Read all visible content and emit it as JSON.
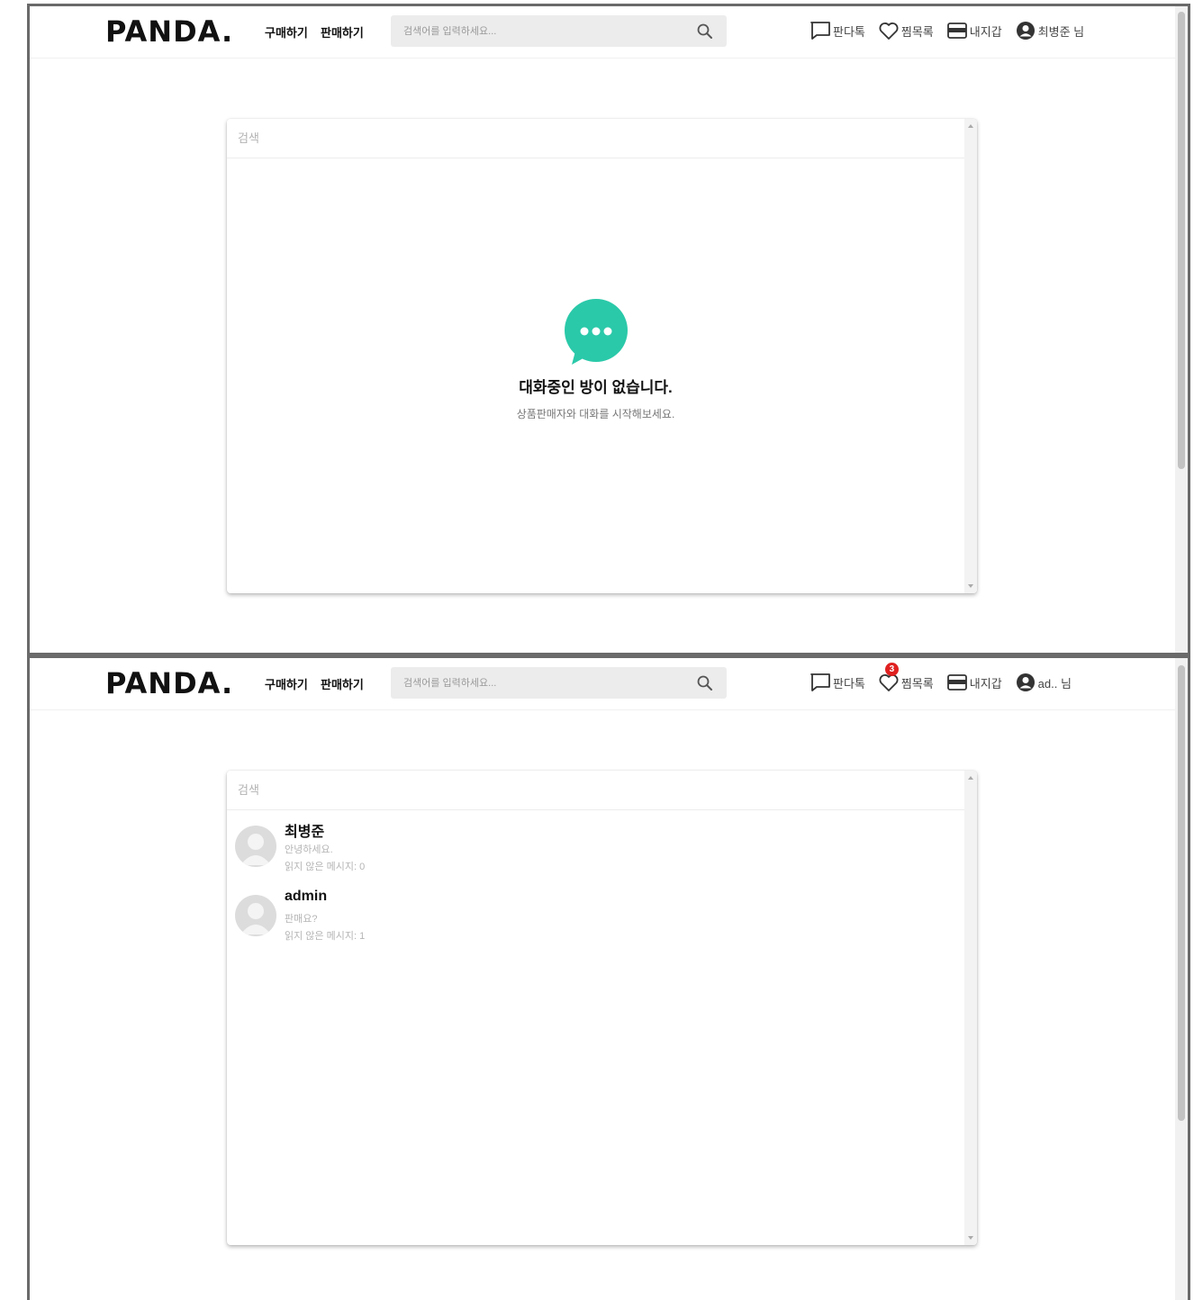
{
  "header": {
    "logo": "PANDA.",
    "nav": {
      "buy": "구매하기",
      "sell": "판매하기"
    },
    "search_placeholder": "검색어를 입력하세요...",
    "menu": {
      "chat": "판다톡",
      "wishlist": "찜목록",
      "wallet": "내지갑"
    }
  },
  "screen1": {
    "user_label": "최병준 님",
    "card_search_placeholder": "검색",
    "empty": {
      "title": "대화중인 방이 없습니다.",
      "subtitle": "상품판매자와 대화를 시작해보세요."
    }
  },
  "screen2": {
    "user_label": "ad.. 님",
    "wishlist_badge": "3",
    "card_search_placeholder": "검색",
    "rooms": [
      {
        "name": "최병준",
        "last_message": "안녕하세요.",
        "unread": "읽지 않은 메시지: 0"
      },
      {
        "name": "admin",
        "last_message": "판매요?",
        "unread": "읽지 않은 메시지: 1"
      }
    ]
  },
  "colors": {
    "accent": "#2ac9a9",
    "badge": "#e02020",
    "search_bg": "#ececec"
  },
  "icons": [
    "search-icon",
    "chat-bubble-icon",
    "heart-icon",
    "wallet-icon",
    "user-circle-icon",
    "chat-dots-icon",
    "avatar-placeholder-icon"
  ]
}
